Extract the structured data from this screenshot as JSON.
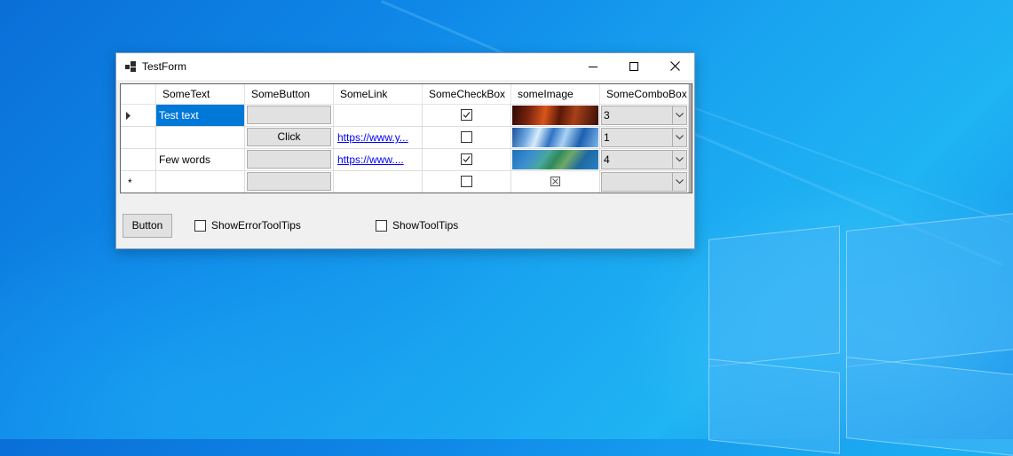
{
  "window": {
    "title": "TestForm"
  },
  "grid": {
    "columns": [
      "SomeText",
      "SomeButton",
      "SomeLink",
      "SomeCheckBox",
      "someImage",
      "SomeComboBox"
    ],
    "rows": [
      {
        "current": true,
        "text": "Test text",
        "button": "",
        "link": "",
        "checked": true,
        "image": "fire",
        "combo": "3"
      },
      {
        "current": false,
        "text": "",
        "button": "Click",
        "link": "https://www.y...",
        "checked": false,
        "image": "ice",
        "combo": "1"
      },
      {
        "current": false,
        "text": "Few words",
        "button": "",
        "link": "https://www....",
        "checked": true,
        "image": "coast",
        "combo": "4"
      },
      {
        "new_row": "*",
        "text": "",
        "button": "",
        "link": "",
        "checked": false,
        "image": "missing",
        "combo": ""
      }
    ]
  },
  "bottom": {
    "button_label": "Button",
    "show_error_tooltips": {
      "label": "ShowErrorToolTips",
      "checked": false
    },
    "show_tooltips": {
      "label": "ShowToolTips",
      "checked": false
    }
  },
  "colors": {
    "selection": "#0078d7",
    "link": "#0000ff",
    "desktop": "#0f88e8"
  }
}
